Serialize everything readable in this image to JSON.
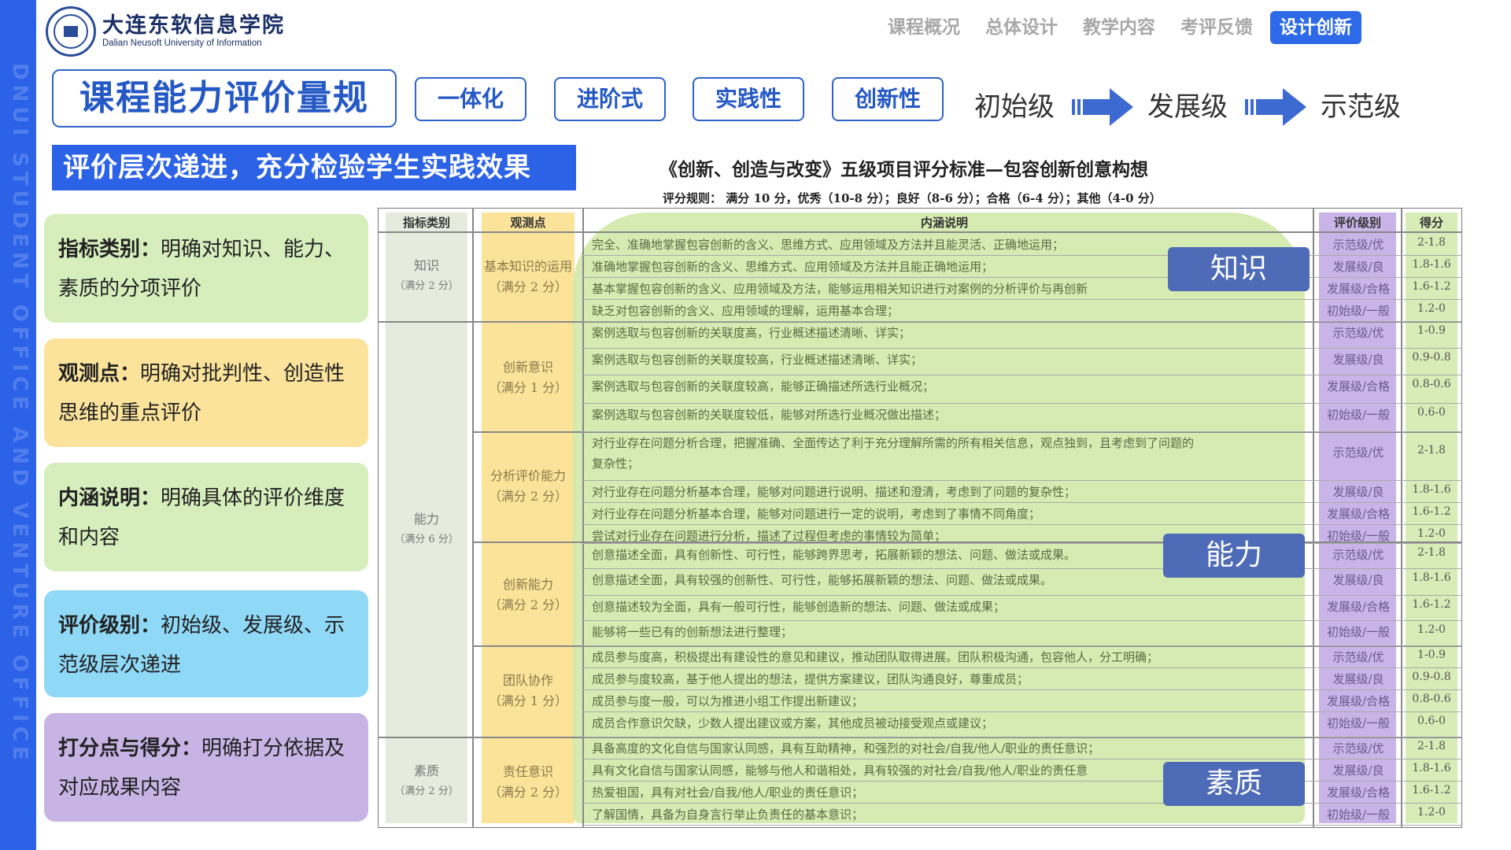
{
  "sidebar_watermark": "DNUI STUDENT OFFICE AND VENTURE OFFICE",
  "logo": {
    "cn": "大连东软信息学院",
    "en": "Dalian Neusoft University of Information"
  },
  "nav": [
    "课程概况",
    "总体设计",
    "教学内容",
    "考评反馈",
    "设计创新"
  ],
  "active_nav_index": 4,
  "main_title": "课程能力评价量规",
  "tags": [
    "一体化",
    "进阶式",
    "实践性",
    "创新性"
  ],
  "levels": [
    "初始级",
    "发展级",
    "示范级"
  ],
  "subtitle": "评价层次递进，充分检验学生实践效果",
  "cards": [
    {
      "label": "指标类别：",
      "text": "明确对知识、能力、素质的分项评价",
      "color": "#d6edbc"
    },
    {
      "label": "观测点：",
      "text": "明确对批判性、创造性思维的重点评价",
      "color": "#fbe39c"
    },
    {
      "label": "内涵说明：",
      "text": "明确具体的评价维度和内容",
      "color": "#d6edbc"
    },
    {
      "label": "评价级别：",
      "text": "初始级、发展级、示范级层次递进",
      "color": "#8fd8f6"
    },
    {
      "label": "打分点与得分：",
      "text": "明确打分依据及对应成果内容",
      "color": "#c7b3e4"
    }
  ],
  "doc": {
    "title": "《创新、创造与改变》五级项目评分标准—包容创新创意构想",
    "rule": "评分规则：  满分 10 分，优秀（10-8 分）；良好（8-6 分）；合格（6-4 分）；其他（4-0 分）",
    "headers": [
      "指标类别",
      "观测点",
      "内涵说明",
      "评价级别",
      "得分"
    ],
    "categories": [
      {
        "name": "知识",
        "full": "（满分 2 分）"
      },
      {
        "name": "能力",
        "full": "（满分 6 分）"
      },
      {
        "name": "素质",
        "full": "（满分 2 分）"
      }
    ],
    "observations": [
      {
        "name": "基本知识的运用",
        "full": "（满分 2 分）"
      },
      {
        "name": "创新意识",
        "full": "（满分 1 分）"
      },
      {
        "name": "分析评价能力",
        "full": "（满分 2 分）"
      },
      {
        "name": "创新能力",
        "full": "（满分 2 分）"
      },
      {
        "name": "团队协作",
        "full": "（满分 1 分）"
      },
      {
        "name": "责任意识",
        "full": "（满分 2 分）"
      }
    ],
    "rows": [
      {
        "text": "完全、准确地掌握包容创新的含义、思维方式、应用领域及方法并且能灵活、正确地运用；",
        "level": "示范级/优",
        "score": "2-1.8"
      },
      {
        "text": "准确地掌握包容创新的含义、思维方式、应用领域及方法并且能正确地运用；",
        "level": "发展级/良",
        "score": "1.8-1.6"
      },
      {
        "text": "基本掌握包容创新的含义、应用领域及方法，能够运用相关知识进行对案例的分析评价与再创新",
        "level": "发展级/合格",
        "score": "1.6-1.2"
      },
      {
        "text": "缺乏对包容创新的含义、应用领域的理解，运用基本合理；",
        "level": "初始级/一般",
        "score": "1.2-0"
      },
      {
        "text": "案例选取与包容创新的关联度高，行业概述描述清晰、详实；",
        "level": "示范级/优",
        "score": "1-0.9"
      },
      {
        "text": "案例选取与包容创新的关联度较高，行业概述描述清晰、详实；",
        "level": "发展级/良",
        "score": "0.9-0.8"
      },
      {
        "text": "案例选取与包容创新的关联度较高，能够正确描述所选行业概况；",
        "level": "发展级/合格",
        "score": "0.8-0.6"
      },
      {
        "text": "案例选取与包容创新的关联度较低，能够对所选行业概况做出描述；",
        "level": "初始级/一般",
        "score": "0.6-0"
      },
      {
        "text": "对行业存在问题分析合理，把握准确、全面传达了利于充分理解所需的所有相关信息，观点独到，且考虑到了问题的",
        "text2": "复杂性；",
        "level": "示范级/优",
        "score": "2-1.8"
      },
      {
        "text": "对行业存在问题分析基本合理，能够对问题进行说明、描述和澄清，考虑到了问题的复杂性；",
        "level": "发展级/良",
        "score": "1.8-1.6"
      },
      {
        "text": "对行业存在问题分析基本合理，能够对问题进行一定的说明，考虑到了事情不同角度；",
        "level": "发展级/合格",
        "score": "1.6-1.2"
      },
      {
        "text": "尝试对行业存在问题进行分析，描述了过程但考虑的事情较为简单；",
        "level": "初始级/一般",
        "score": "1.2-0"
      },
      {
        "text": "创意描述全面，具有创新性、可行性，能够跨界思考，拓展新颖的想法、问题、做法或成果。",
        "level": "示范级/优",
        "score": "2-1.8"
      },
      {
        "text": "创意描述全面，具有较强的创新性、可行性，能够拓展新颖的想法、问题、做法或成果。",
        "level": "发展级/良",
        "score": "1.8-1.6"
      },
      {
        "text": "创意描述较为全面，具有一般可行性，能够创造新的想法、问题、做法或成果；",
        "level": "发展级/合格",
        "score": "1.6-1.2"
      },
      {
        "text": "能够将一些已有的创新想法进行整理；",
        "level": "初始级/一般",
        "score": "1.2-0"
      },
      {
        "text": "成员参与度高，积极提出有建设性的意见和建议，推动团队取得进展。团队积极沟通，包容他人，分工明确；",
        "level": "示范级/优",
        "score": "1-0.9"
      },
      {
        "text": "成员参与度较高，基于他人提出的想法，提供方案建议，团队沟通良好，尊重成员；",
        "level": "发展级/良",
        "score": "0.9-0.8"
      },
      {
        "text": "成员参与度一般，可以为推进小组工作提出新建议；",
        "level": "发展级/合格",
        "score": "0.8-0.6"
      },
      {
        "text": "成员合作意识欠缺，少数人提出建议或方案，其他成员被动接受观点或建议；",
        "level": "初始级/一般",
        "score": "0.6-0"
      },
      {
        "text": "具备高度的文化自信与国家认同感，具有互助精神，和强烈的对社会/自我/他人/职业的责任意识；",
        "level": "示范级/优",
        "score": "2-1.8"
      },
      {
        "text": "具有文化自信与国家认同感，能够与他人和谐相处，具有较强的对社会/自我/他人/职业的责任意",
        "level": "发展级/良",
        "score": "1.8-1.6"
      },
      {
        "text": "热爱祖国，具有对社会/自我/他人/职业的责任意识；",
        "level": "发展级/合格",
        "score": "1.6-1.2"
      },
      {
        "text": "了解国情，具备为自身言行举止负责任的基本意识；",
        "level": "初始级/一般",
        "score": "1.2-0"
      }
    ]
  },
  "badges": [
    "知识",
    "能力",
    "素质"
  ]
}
